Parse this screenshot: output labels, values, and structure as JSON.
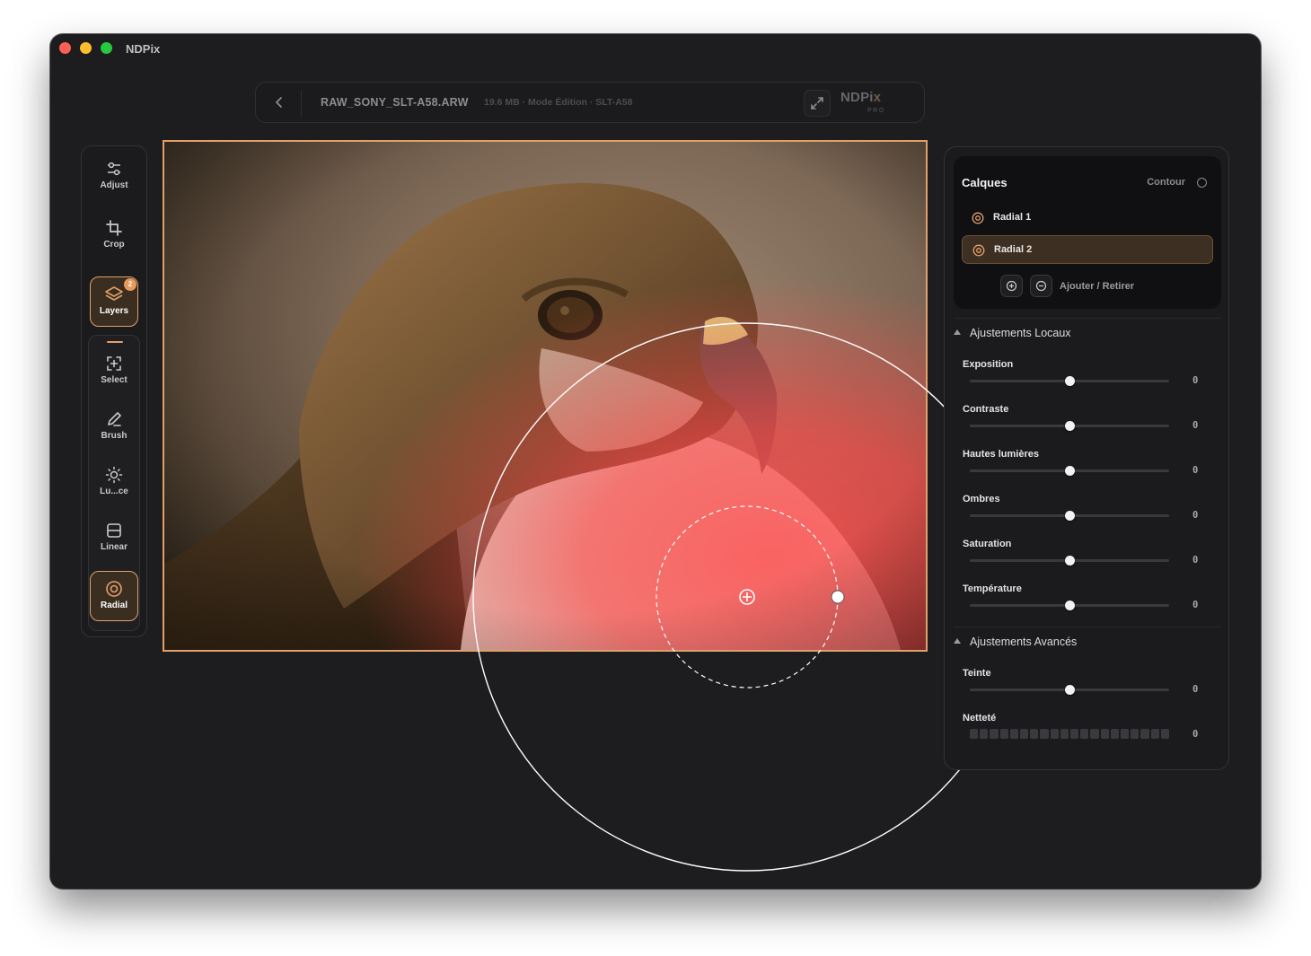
{
  "app": {
    "title": "NDPix"
  },
  "topbar": {
    "file_name": "RAW_SONY_SLT-A58.ARW",
    "file_meta": "19.6 MB · Mode Édition · SLT-A58",
    "logo": "NDPi",
    "logo_accent": "x",
    "logo_sub": "PRO"
  },
  "toolbar": {
    "tools": [
      {
        "label": "Adjust",
        "icon": "sliders-icon"
      },
      {
        "label": "Crop",
        "icon": "crop-icon"
      },
      {
        "label": "Layers",
        "icon": "layers-icon",
        "badge": "2",
        "active": true
      }
    ],
    "group": [
      {
        "label": "Select",
        "icon": "select-icon"
      },
      {
        "label": "Brush",
        "icon": "brush-icon"
      },
      {
        "label": "Lu...ce",
        "icon": "sun-icon"
      },
      {
        "label": "Linear",
        "icon": "linear-gradient-icon"
      },
      {
        "label": "Radial",
        "icon": "radial-gradient-icon",
        "active": true
      }
    ]
  },
  "layers": {
    "title": "Calques",
    "contour_label": "Contour",
    "items": [
      {
        "name": "Radial 1",
        "active": false
      },
      {
        "name": "Radial 2",
        "active": true
      }
    ],
    "add_remove_label": "Ajouter / Retirer"
  },
  "local_adjustments": {
    "title": "Ajustements Locaux",
    "sliders": [
      {
        "label": "Exposition",
        "value": "0",
        "level": 0.5
      },
      {
        "label": "Contraste",
        "value": "0",
        "level": 0.5
      },
      {
        "label": "Hautes lumières",
        "value": "0",
        "level": 0.5
      },
      {
        "label": "Ombres",
        "value": "0",
        "level": 0.5
      },
      {
        "label": "Saturation",
        "value": "0",
        "level": 0.5
      },
      {
        "label": "Température",
        "value": "0",
        "level": 0.5
      }
    ]
  },
  "advanced_adjustments": {
    "title": "Ajustements Avancés",
    "sliders": [
      {
        "label": "Teinte",
        "value": "0",
        "level": 0.5
      },
      {
        "label": "Netteté",
        "value": "0",
        "segmented": true
      }
    ]
  },
  "colors": {
    "accent": "#e2a06a",
    "background": "#1d1d1f",
    "mask_overlay": "#ff4d4d"
  }
}
